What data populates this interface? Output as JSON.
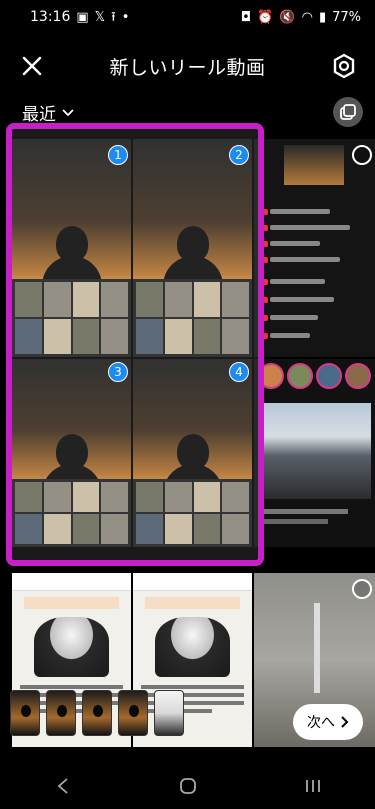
{
  "status_bar": {
    "time": "13:16",
    "battery": "77%",
    "left_icons": [
      "gallery-icon",
      "x-app-icon",
      "upload-icon",
      "dot-icon"
    ],
    "right_icons": [
      "nfc-icon",
      "alarm-icon",
      "mute-icon",
      "wifi-icon",
      "signal-icon"
    ]
  },
  "header": {
    "title": "新しいリール動画",
    "close_icon": "close-icon",
    "settings_icon": "gear-icon"
  },
  "album": {
    "label": "最近",
    "chevron": "chevron-down-icon",
    "multi_select_icon": "multi-select-icon"
  },
  "selection_badges": [
    "1",
    "2",
    "3",
    "4"
  ],
  "selected_tray": {
    "count": 5
  },
  "next_button": {
    "label": "次へ"
  },
  "navbar": {
    "back": "back-icon",
    "home": "home-icon",
    "recents": "recents-icon"
  },
  "colors": {
    "selection_outline": "#c81fc8",
    "badge": "#1d8bf1",
    "background": "#000000"
  }
}
